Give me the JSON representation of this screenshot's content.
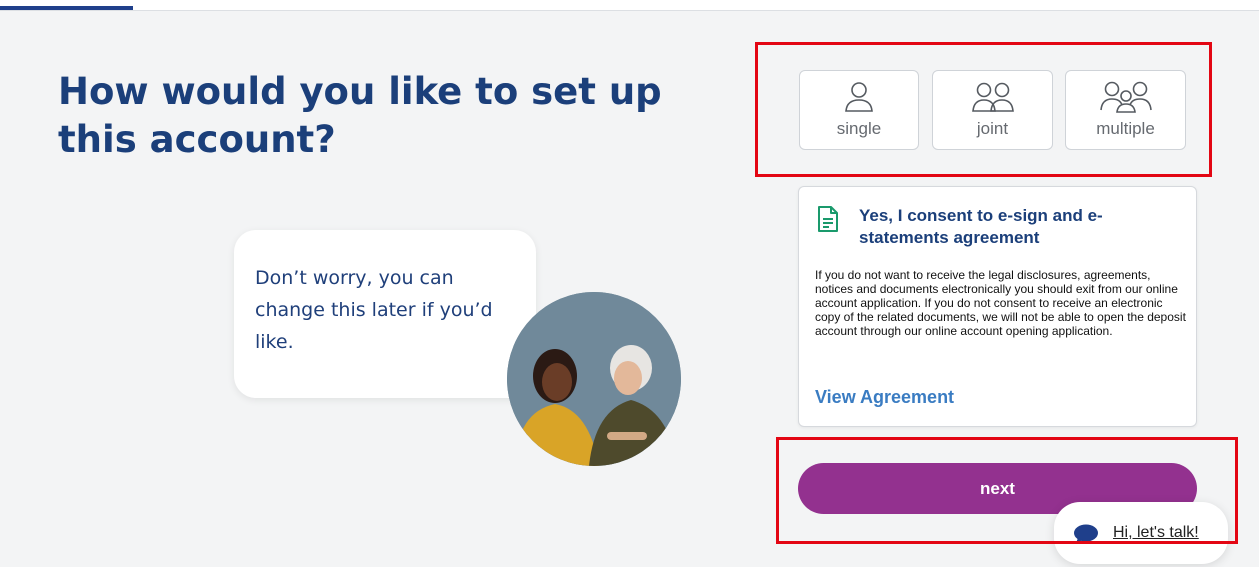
{
  "heading": "How would you like to set up this account?",
  "reassurance": "Don’t worry, you can change this later if you’d like.",
  "account_types": [
    {
      "label": "single",
      "icon": "person-icon"
    },
    {
      "label": "joint",
      "icon": "two-people-icon"
    },
    {
      "label": "multiple",
      "icon": "group-icon"
    }
  ],
  "consent": {
    "title": "Yes, I consent to e-sign and e-statements agreement",
    "body": "If you do not want to receive the legal disclosures, agreements, notices and documents electronically you should exit from our online account application. If you do not consent to receive an electronic copy of the related documents, we will not be able to open the deposit account through our online account opening application.",
    "link": "View Agreement",
    "icon": "document-icon"
  },
  "next_label": "next",
  "chat_label": "Hi, let's talk!",
  "colors": {
    "brand_blue": "#1b3f7a",
    "primary_purple": "#93318f",
    "link_blue": "#3a7cc2",
    "consent_icon_green": "#1a9a6c"
  }
}
